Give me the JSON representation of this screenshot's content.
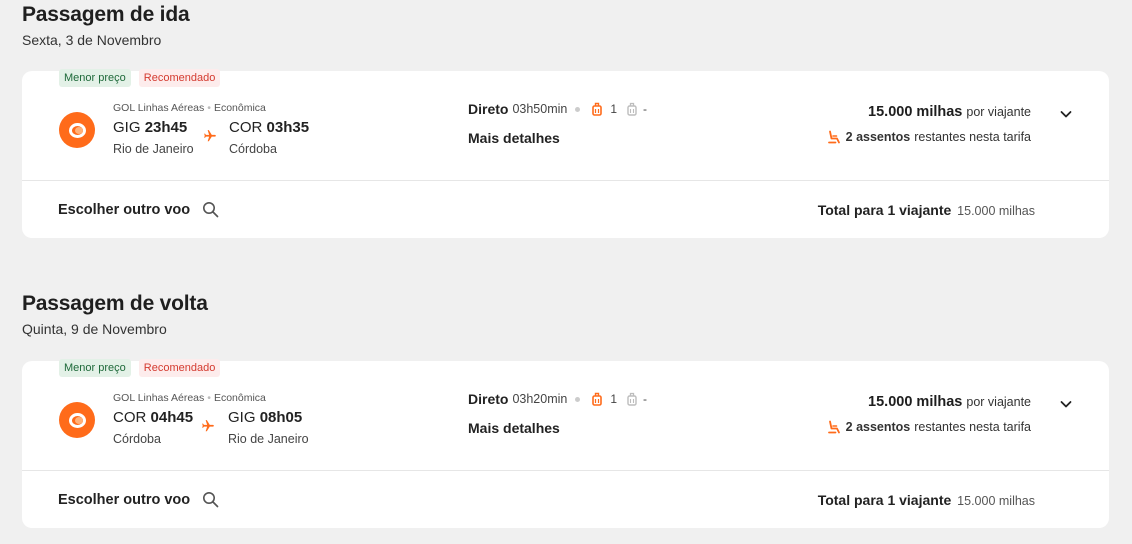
{
  "outbound": {
    "title": "Passagem de ida",
    "date": "Sexta, 3 de Novembro",
    "badges": {
      "cheapest": "Menor preço",
      "recommended": "Recomendado"
    },
    "airline": "GOL Linhas Aéreas",
    "cabin": "Econômica",
    "origin": {
      "code": "GIG",
      "time": "23h45",
      "city": "Rio de Janeiro"
    },
    "destination": {
      "code": "COR",
      "time": "03h35",
      "city": "Córdoba"
    },
    "stops_label": "Direto",
    "duration": "03h50min",
    "carry_on_count": "1",
    "checked_bag": "-",
    "details_link": "Mais detalhes",
    "price_miles": "15.000 milhas",
    "price_per": "por viajante",
    "seats_count": "2 assentos",
    "seats_text": "restantes nesta tarifa",
    "choose_other": "Escolher outro voo",
    "total_label": "Total para 1 viajante",
    "total_value": "15.000 milhas"
  },
  "inbound": {
    "title": "Passagem de volta",
    "date": "Quinta, 9 de Novembro",
    "badges": {
      "cheapest": "Menor preço",
      "recommended": "Recomendado"
    },
    "airline": "GOL Linhas Aéreas",
    "cabin": "Econômica",
    "origin": {
      "code": "COR",
      "time": "04h45",
      "city": "Córdoba"
    },
    "destination": {
      "code": "GIG",
      "time": "08h05",
      "city": "Rio de Janeiro"
    },
    "stops_label": "Direto",
    "duration": "03h20min",
    "carry_on_count": "1",
    "checked_bag": "-",
    "details_link": "Mais detalhes",
    "price_miles": "15.000 milhas",
    "price_per": "por viajante",
    "seats_count": "2 assentos",
    "seats_text": "restantes nesta tarifa",
    "choose_other": "Escolher outro voo",
    "total_label": "Total para 1 viajante",
    "total_value": "15.000 milhas"
  },
  "colors": {
    "accent": "#ff6b1a",
    "background": "#f0f0f0",
    "badge_green": "#1e6a3a",
    "badge_red": "#d43a2f"
  },
  "icons": [
    "gol-logo-icon",
    "airplane-icon",
    "carry-on-bag-icon",
    "checked-bag-icon",
    "seat-icon",
    "chevron-down-icon",
    "search-icon"
  ]
}
